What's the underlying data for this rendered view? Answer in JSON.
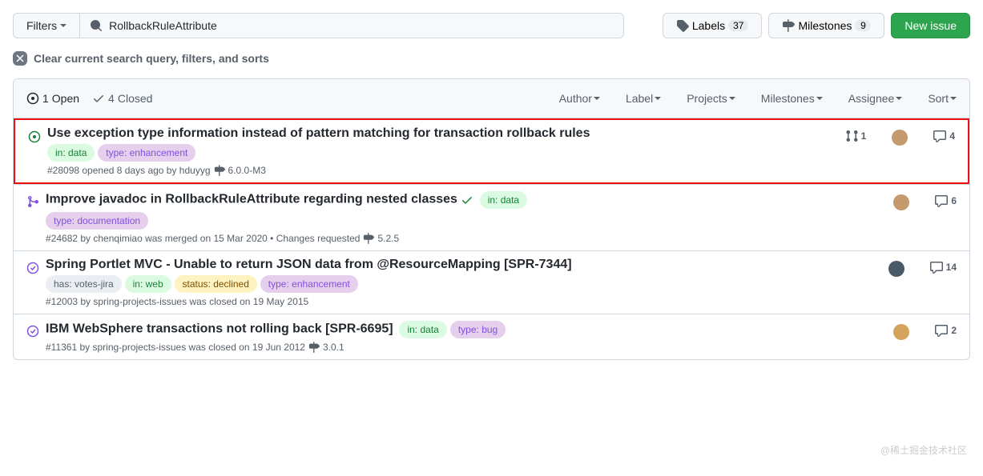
{
  "toolbar": {
    "filters_label": "Filters",
    "search_value": "RollbackRuleAttribute",
    "labels_label": "Labels",
    "labels_count": "37",
    "milestones_label": "Milestones",
    "milestones_count": "9",
    "new_issue_label": "New issue"
  },
  "clear": {
    "label": "Clear current search query, filters, and sorts"
  },
  "list_header": {
    "open_count": "1",
    "open_label": "Open",
    "closed_count": "4",
    "closed_label": "Closed",
    "filters": [
      "Author",
      "Label",
      "Projects",
      "Milestones",
      "Assignee",
      "Sort"
    ]
  },
  "label_colors": {
    "in_data": {
      "bg": "#dafbe1",
      "fg": "#1a7f37"
    },
    "type_enhancement": {
      "bg": "#e6ceed",
      "fg": "#8250df"
    },
    "type_documentation": {
      "bg": "#e6ceed",
      "fg": "#8250df"
    },
    "has_votes_jira": {
      "bg": "#eaeef2",
      "fg": "#57606a"
    },
    "in_web": {
      "bg": "#dafbe1",
      "fg": "#1a7f37"
    },
    "status_declined": {
      "bg": "#fef2c0",
      "fg": "#7d4e00"
    },
    "type_bug": {
      "bg": "#e6ceed",
      "fg": "#8250df"
    }
  },
  "issues": [
    {
      "highlighted": true,
      "status": "open",
      "title": "Use exception type information instead of pattern matching for transaction rollback rules",
      "labels": [
        {
          "text": "in: data",
          "color_key": "in_data"
        },
        {
          "text": "type: enhancement",
          "color_key": "type_enhancement"
        }
      ],
      "labels_below": true,
      "meta": "#28098 opened 8 days ago by hduyyg",
      "milestone": "6.0.0-M3",
      "pr_count": "1",
      "comments": "4",
      "avatar_color": "#c49a6c"
    },
    {
      "status": "merged",
      "title": "Improve javadoc in RollbackRuleAttribute regarding nested classes",
      "check": true,
      "labels": [
        {
          "text": "in: data",
          "color_key": "in_data"
        },
        {
          "text": "type: documentation",
          "color_key": "type_documentation"
        }
      ],
      "labels_split": 1,
      "meta": "#24682 by chenqimiao was merged on 15 Mar 2020 • Changes requested",
      "milestone": "5.2.5",
      "comments": "6",
      "avatar_color": "#c49a6c"
    },
    {
      "status": "closed",
      "title": "Spring Portlet MVC - Unable to return JSON data from @ResourceMapping [SPR-7344]",
      "labels": [
        {
          "text": "has: votes-jira",
          "color_key": "has_votes_jira"
        },
        {
          "text": "in: web",
          "color_key": "in_web"
        },
        {
          "text": "status: declined",
          "color_key": "status_declined"
        },
        {
          "text": "type: enhancement",
          "color_key": "type_enhancement"
        }
      ],
      "labels_below": true,
      "meta": "#12003 by spring-projects-issues was closed on 19 May 2015",
      "comments": "14",
      "avatar_color": "#4a5a6a"
    },
    {
      "status": "closed",
      "title": "IBM WebSphere transactions not rolling back [SPR-6695]",
      "labels": [
        {
          "text": "in: data",
          "color_key": "in_data"
        },
        {
          "text": "type: bug",
          "color_key": "type_bug"
        }
      ],
      "meta": "#11361 by spring-projects-issues was closed on 19 Jun 2012",
      "milestone": "3.0.1",
      "comments": "2",
      "avatar_color": "#d4a35c"
    }
  ],
  "watermark": "@稀土掘金技术社区"
}
